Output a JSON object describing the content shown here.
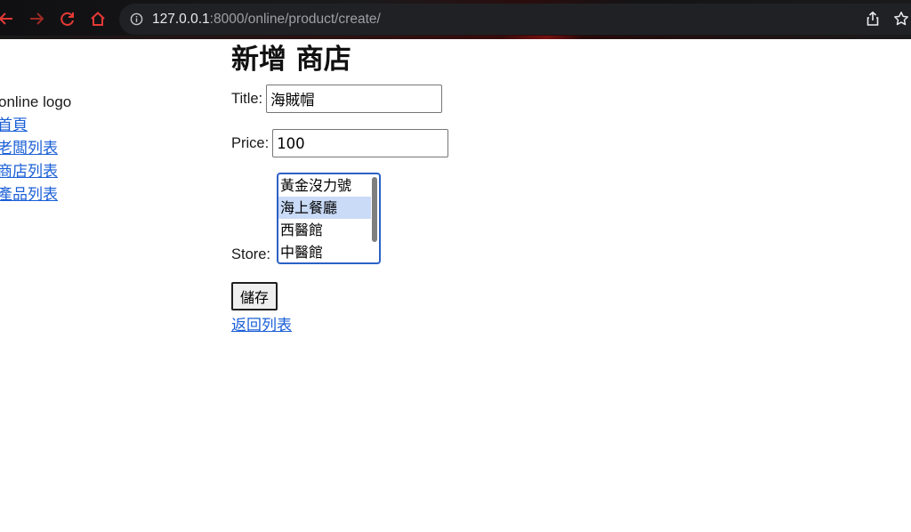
{
  "browser": {
    "url_host": "127.0.0.1",
    "url_path": ":8000/online/product/create/"
  },
  "sidebar": {
    "logo_text": "online logo",
    "links": [
      "首頁",
      "老闆列表",
      "商店列表",
      "產品列表"
    ]
  },
  "form": {
    "title": "新增 商店",
    "title_label": "Title:",
    "title_value": "海賊帽",
    "price_label": "Price:",
    "price_value": "100",
    "store_label": "Store:",
    "store_options": [
      "黃金沒力號",
      "海上餐廳",
      "西醫館",
      "中醫館"
    ],
    "store_selected": "海上餐廳",
    "save_label": "儲存",
    "back_label": "返回列表"
  },
  "colors": {
    "link": "#1a5fd6",
    "nav_icon": "#e53935",
    "focus_border": "#2b62c5",
    "selected_option": "#c9dbf7"
  }
}
